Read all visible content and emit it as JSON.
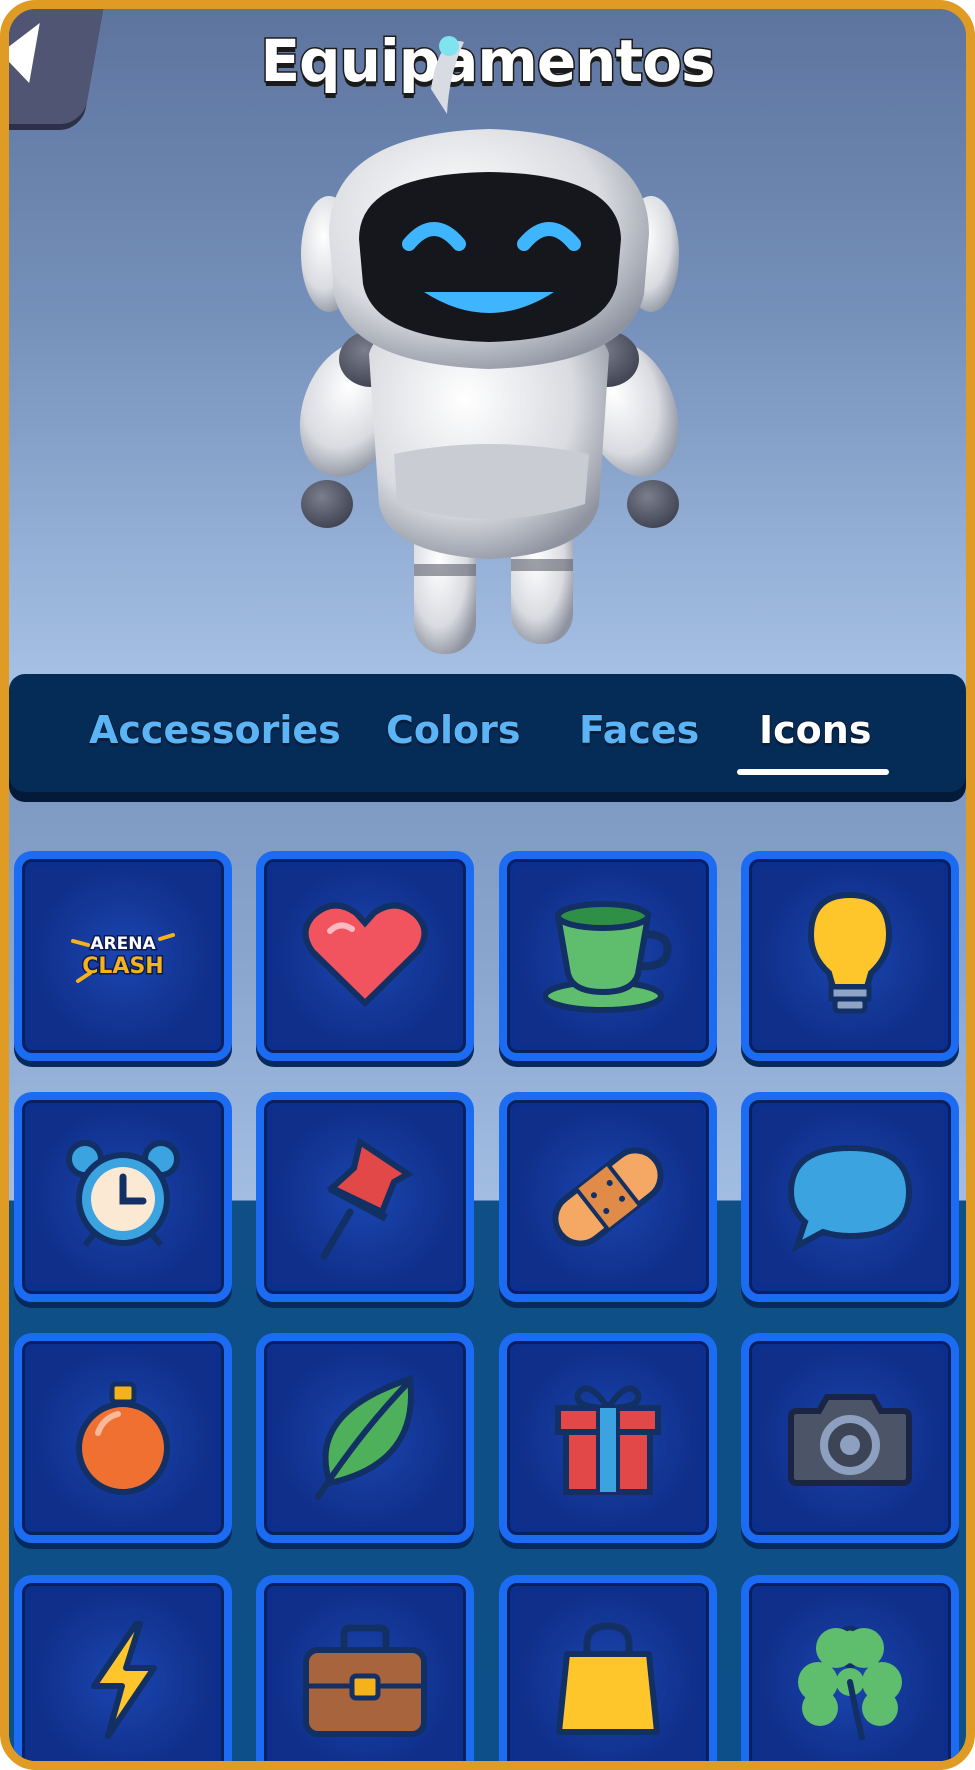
{
  "header": {
    "title": "Equipamentos",
    "back_icon": "back-arrow-icon"
  },
  "tabs": [
    {
      "label": "Accessories",
      "active": false
    },
    {
      "label": "Colors",
      "active": false
    },
    {
      "label": "Faces",
      "active": false
    },
    {
      "label": "Icons",
      "active": true
    }
  ],
  "icons": [
    {
      "name": "arena-clash-logo-icon",
      "logo_line1": "ARENA",
      "logo_line2": "CLASH"
    },
    {
      "name": "heart-icon"
    },
    {
      "name": "teacup-icon"
    },
    {
      "name": "lightbulb-icon"
    },
    {
      "name": "alarm-clock-icon"
    },
    {
      "name": "pushpin-icon"
    },
    {
      "name": "bandage-icon"
    },
    {
      "name": "speech-bubble-icon"
    },
    {
      "name": "ornament-icon"
    },
    {
      "name": "leaf-icon"
    },
    {
      "name": "gift-icon"
    },
    {
      "name": "camera-icon"
    },
    {
      "name": "lightning-icon"
    },
    {
      "name": "briefcase-icon"
    },
    {
      "name": "shopping-bag-icon"
    },
    {
      "name": "clover-icon"
    }
  ],
  "colors": {
    "frame": "#e09b24",
    "tab_active": "#ffffff",
    "tab_inactive": "#5ab4f5",
    "cell_border": "#1b6cf2"
  }
}
